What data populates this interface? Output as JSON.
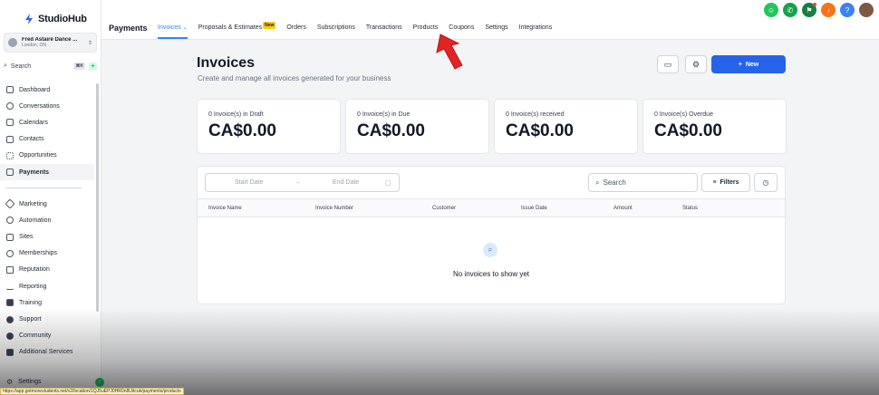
{
  "app": {
    "name": "StudioHub"
  },
  "account": {
    "name": "Fred Astaire Dance ...",
    "location": "London, ON"
  },
  "search": {
    "label": "Search",
    "shortcut": "⌘K",
    "add": "+"
  },
  "sidebar": {
    "items": [
      {
        "label": "Dashboard"
      },
      {
        "label": "Conversations"
      },
      {
        "label": "Calendars"
      },
      {
        "label": "Contacts"
      },
      {
        "label": "Opportunities"
      },
      {
        "label": "Payments"
      },
      {
        "label": "Marketing"
      },
      {
        "label": "Automation"
      },
      {
        "label": "Sites"
      },
      {
        "label": "Memberships"
      },
      {
        "label": "Reputation"
      },
      {
        "label": "Reporting"
      },
      {
        "label": "Training"
      },
      {
        "label": "Support"
      },
      {
        "label": "Community"
      },
      {
        "label": "Additional Services"
      }
    ],
    "settings": "Settings"
  },
  "topbar": {
    "title": "Payments",
    "tabs": [
      "Invoices",
      "Proposals & Estimates",
      "Orders",
      "Subscriptions",
      "Transactions",
      "Products",
      "Coupons",
      "Settings",
      "Integrations"
    ],
    "new_badge": "New"
  },
  "header": {
    "title": "Invoices",
    "subtitle": "Create and manage all invoices generated for your business",
    "new_button": "New"
  },
  "stats": [
    {
      "label": "0 Invoice(s) in Draft",
      "value": "CA$0.00"
    },
    {
      "label": "0 Invoice(s) in Due",
      "value": "CA$0.00"
    },
    {
      "label": "0 Invoice(s) received",
      "value": "CA$0.00"
    },
    {
      "label": "0 Invoice(s) Overdue",
      "value": "CA$0.00"
    }
  ],
  "filters": {
    "start_date": "Start Date",
    "end_date": "End Date",
    "search_placeholder": "Search",
    "filters_label": "Filters"
  },
  "table": {
    "columns": [
      "Invoice Name",
      "Invoice Number",
      "Customer",
      "Issue Date",
      "Amount",
      "Status"
    ],
    "empty": "No invoices to show yet"
  },
  "status_bar": {
    "url": "https://app.gotmorestudents.net/v2/location/1QJ5uEPJ0HR0n8Uitcuk/payments/products"
  },
  "colors": {
    "accent": "#2563eb",
    "active_tab": "#3b82f6"
  }
}
